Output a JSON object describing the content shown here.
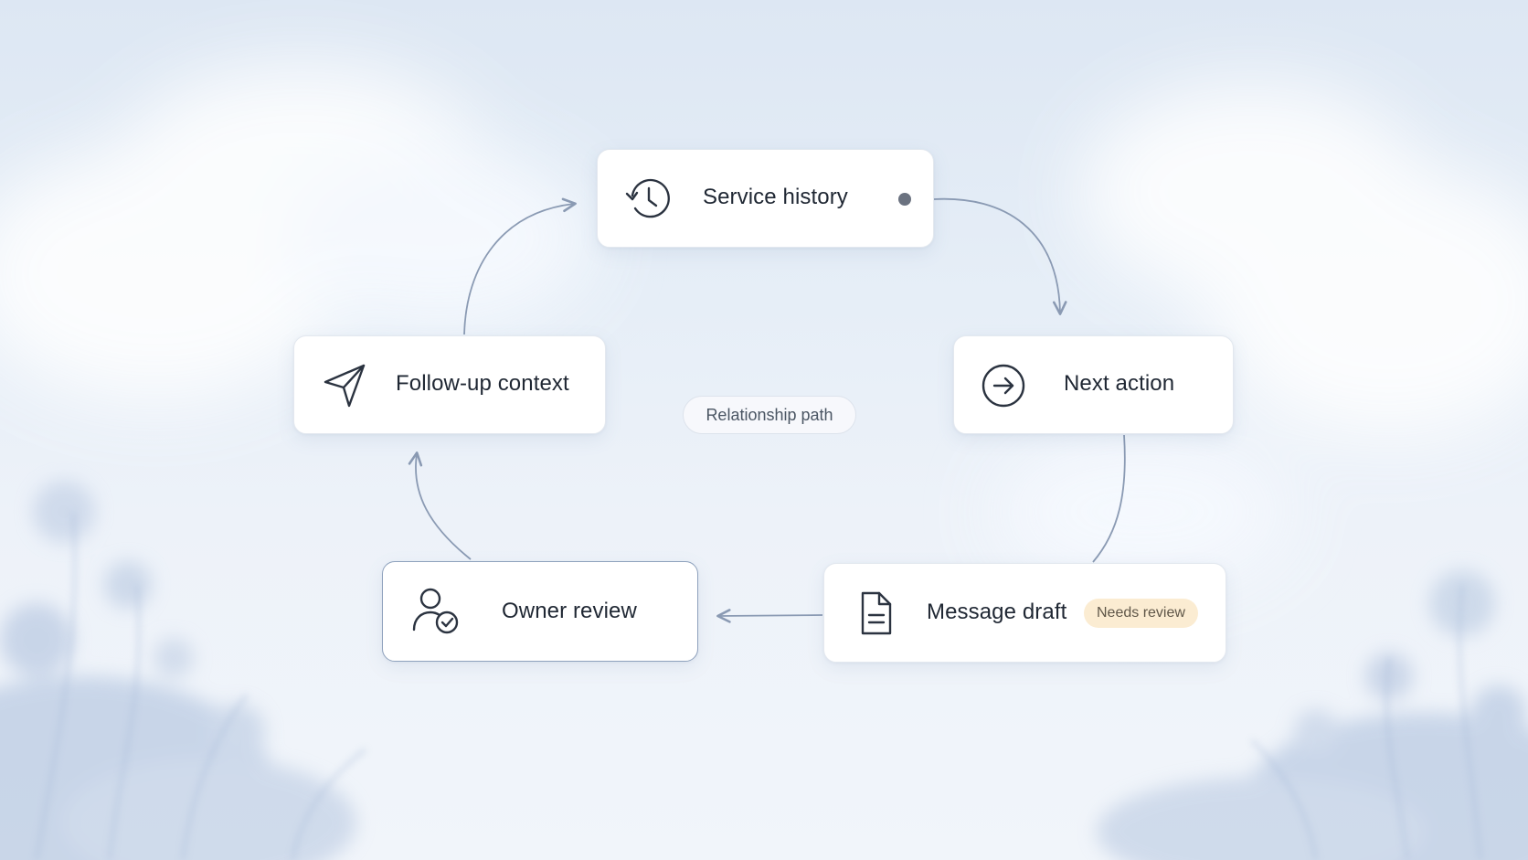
{
  "nodes": {
    "service_history": {
      "label": "Service history",
      "icon": "history-clock-icon",
      "status": "dot"
    },
    "next_action": {
      "label": "Next action",
      "icon": "arrow-right-circle-icon"
    },
    "message_draft": {
      "label": "Message draft",
      "icon": "document-icon",
      "badge": "Needs review"
    },
    "owner_review": {
      "label": "Owner review",
      "icon": "user-check-icon"
    },
    "followup_context": {
      "label": "Follow-up context",
      "icon": "paper-plane-icon"
    }
  },
  "center_label": "Relationship path",
  "colors": {
    "connector": "#8a9ab3",
    "badge_bg": "#fbecd2",
    "status_dot": "#6b7280",
    "text": "#1f2733"
  }
}
